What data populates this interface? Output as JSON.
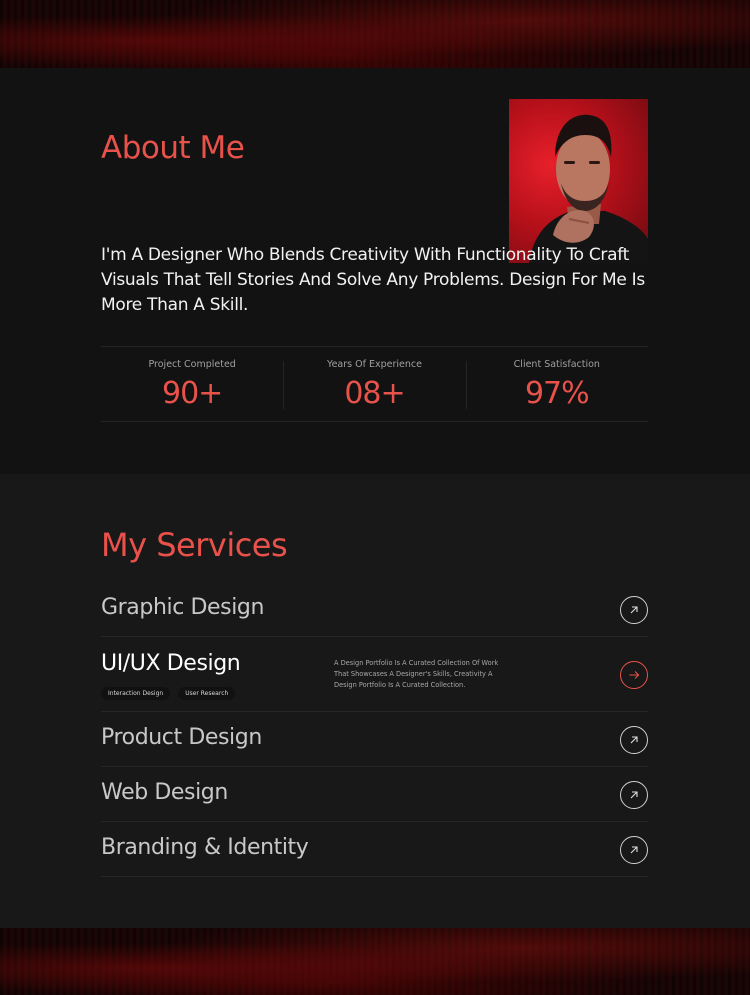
{
  "about": {
    "title": "About Me",
    "intro": "I'm A Designer Who Blends Creativity With Functionality To Craft Visuals That Tell Stories And Solve Any Problems. Design For Me Is More Than A Skill.",
    "stats": [
      {
        "label": "Project Completed",
        "value": "90+"
      },
      {
        "label": "Years Of Experience",
        "value": "08+"
      },
      {
        "label": "Client Satisfaction",
        "value": "97%"
      }
    ]
  },
  "services": {
    "title": "My Services",
    "items": [
      {
        "name": "Graphic Design"
      },
      {
        "name": "UI/UX Design",
        "tags": [
          "Interaction Design",
          "User Research"
        ],
        "description": "A Design Portfolio Is A Curated Collection Of Work That Showcases A Designer's Skills, Creativity A Design Portfolio Is A Curated Collection."
      },
      {
        "name": "Product Design"
      },
      {
        "name": "Web Design"
      },
      {
        "name": "Branding & Identity"
      }
    ]
  },
  "colors": {
    "accent": "#e8524a",
    "background": "#121212",
    "surface": "#181818"
  },
  "icons": {
    "arrow": "arrow-up-right-icon",
    "arrow_active": "arrow-right-icon"
  }
}
